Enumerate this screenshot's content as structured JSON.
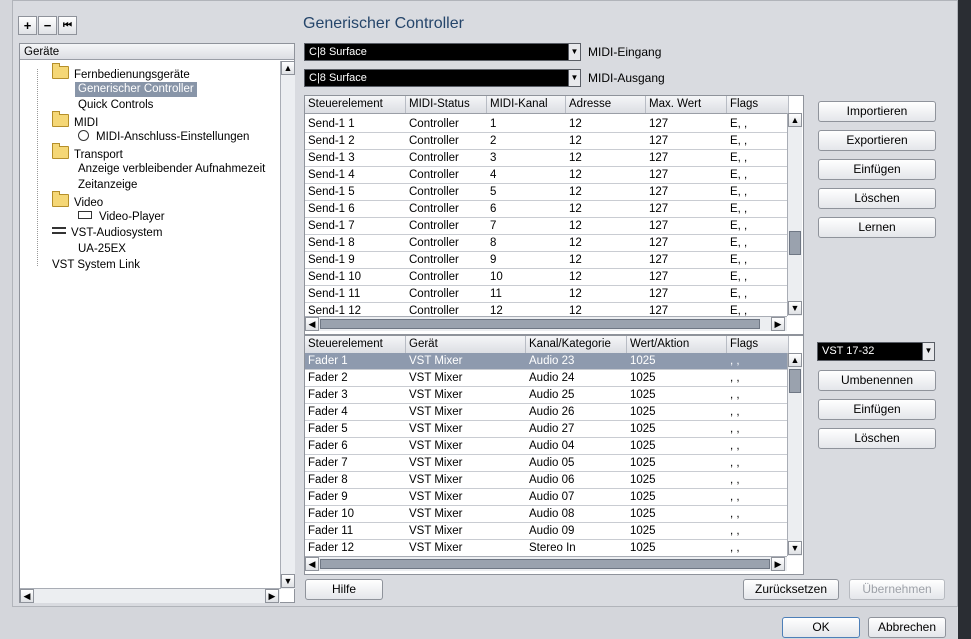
{
  "title": "Generischer Controller",
  "toolbar": {
    "add": "+",
    "remove": "−",
    "reset": "⏮"
  },
  "devices": {
    "header": "Geräte",
    "tree": [
      {
        "label": "Fernbedienungsgeräte"
      },
      {
        "label": "Generischer Controller"
      },
      {
        "label": "Quick Controls"
      },
      {
        "label": "MIDI"
      },
      {
        "label": "MIDI-Anschluss-Einstellungen"
      },
      {
        "label": "Transport"
      },
      {
        "label": "Anzeige verbleibender Aufnahmezeit"
      },
      {
        "label": "Zeitanzeige"
      },
      {
        "label": "Video"
      },
      {
        "label": "Video-Player"
      },
      {
        "label": "VST-Audiosystem"
      },
      {
        "label": "UA-25EX"
      },
      {
        "label": "VST System Link"
      }
    ]
  },
  "midi": {
    "input_value": "C|8 Surface",
    "input_label": "MIDI-Eingang",
    "output_value": "C|8 Surface",
    "output_label": "MIDI-Ausgang"
  },
  "table1": {
    "headers": [
      "Steuerelement",
      "MIDI-Status",
      "MIDI-Kanal",
      "Adresse",
      "Max. Wert",
      "Flags"
    ],
    "rows": [
      [
        "Send-1 1",
        "Controller",
        "1",
        "12",
        "127",
        "E, ,"
      ],
      [
        "Send-1 2",
        "Controller",
        "2",
        "12",
        "127",
        "E, ,"
      ],
      [
        "Send-1 3",
        "Controller",
        "3",
        "12",
        "127",
        "E, ,"
      ],
      [
        "Send-1 4",
        "Controller",
        "4",
        "12",
        "127",
        "E, ,"
      ],
      [
        "Send-1 5",
        "Controller",
        "5",
        "12",
        "127",
        "E, ,"
      ],
      [
        "Send-1 6",
        "Controller",
        "6",
        "12",
        "127",
        "E, ,"
      ],
      [
        "Send-1 7",
        "Controller",
        "7",
        "12",
        "127",
        "E, ,"
      ],
      [
        "Send-1 8",
        "Controller",
        "8",
        "12",
        "127",
        "E, ,"
      ],
      [
        "Send-1 9",
        "Controller",
        "9",
        "12",
        "127",
        "E, ,"
      ],
      [
        "Send-1 10",
        "Controller",
        "10",
        "12",
        "127",
        "E, ,"
      ],
      [
        "Send-1 11",
        "Controller",
        "11",
        "12",
        "127",
        "E, ,"
      ],
      [
        "Send-1 12",
        "Controller",
        "12",
        "12",
        "127",
        "E, ,"
      ]
    ]
  },
  "table2": {
    "headers": [
      "Steuerelement",
      "Gerät",
      "Kanal/Kategorie",
      "Wert/Aktion",
      "Flags"
    ],
    "rows": [
      [
        "Fader 1",
        "VST Mixer",
        "Audio 23",
        "1025",
        ", ,"
      ],
      [
        "Fader 2",
        "VST Mixer",
        "Audio 24",
        "1025",
        ", ,"
      ],
      [
        "Fader 3",
        "VST Mixer",
        "Audio 25",
        "1025",
        ", ,"
      ],
      [
        "Fader 4",
        "VST Mixer",
        "Audio 26",
        "1025",
        ", ,"
      ],
      [
        "Fader 5",
        "VST Mixer",
        "Audio 27",
        "1025",
        ", ,"
      ],
      [
        "Fader 6",
        "VST Mixer",
        "Audio 04",
        "1025",
        ", ,"
      ],
      [
        "Fader 7",
        "VST Mixer",
        "Audio 05",
        "1025",
        ", ,"
      ],
      [
        "Fader 8",
        "VST Mixer",
        "Audio 06",
        "1025",
        ", ,"
      ],
      [
        "Fader 9",
        "VST Mixer",
        "Audio 07",
        "1025",
        ", ,"
      ],
      [
        "Fader 10",
        "VST Mixer",
        "Audio 08",
        "1025",
        ", ,"
      ],
      [
        "Fader 11",
        "VST Mixer",
        "Audio 09",
        "1025",
        ", ,"
      ],
      [
        "Fader 12",
        "VST Mixer",
        "Stereo In",
        "1025",
        ", ,"
      ]
    ]
  },
  "side_buttons": [
    "Importieren",
    "Exportieren",
    "Einfügen",
    "Löschen",
    "Lernen"
  ],
  "bank": {
    "value": "VST 17-32"
  },
  "bank_buttons": [
    "Umbenennen",
    "Einfügen",
    "Löschen"
  ],
  "footer": {
    "help": "Hilfe",
    "reset": "Zurücksetzen",
    "apply": "Übernehmen",
    "ok": "OK",
    "cancel": "Abbrechen"
  }
}
